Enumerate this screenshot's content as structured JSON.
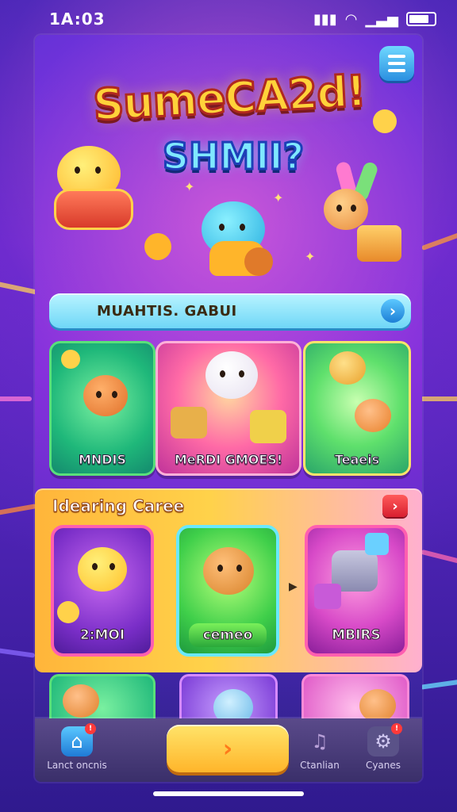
{
  "status_bar": {
    "time": "1A:03"
  },
  "header": {
    "title_line1": "SumeCA2d!",
    "title_line2": "SHMII?",
    "menu_icon": "hamburger-menu-icon"
  },
  "search": {
    "text": "MUAHTIS. GABUI",
    "go_icon": "chevron-right-icon"
  },
  "top_cards": [
    {
      "label": "MNDIS"
    },
    {
      "label": "MeRDI GMOES!"
    },
    {
      "label": "Teaeis"
    }
  ],
  "featured": {
    "title": "Idearing Caree",
    "cards": [
      {
        "label": "2:MOI"
      },
      {
        "label": "cemeo"
      },
      {
        "label": "MBIRS"
      }
    ]
  },
  "nav": {
    "items": [
      {
        "label": "Lanct oncnis",
        "icon": "home-icon"
      },
      {
        "label": "Ctanlian",
        "icon": "music-icon"
      },
      {
        "label": "Cyanes",
        "icon": "settings-icon"
      }
    ],
    "play_icon": "play-chevron-icon"
  },
  "colors": {
    "accent_yellow": "#ffd23a",
    "accent_cyan": "#7fe8ff",
    "badge_red": "#ff3a3a",
    "featured_orange": "#ffb53a"
  }
}
